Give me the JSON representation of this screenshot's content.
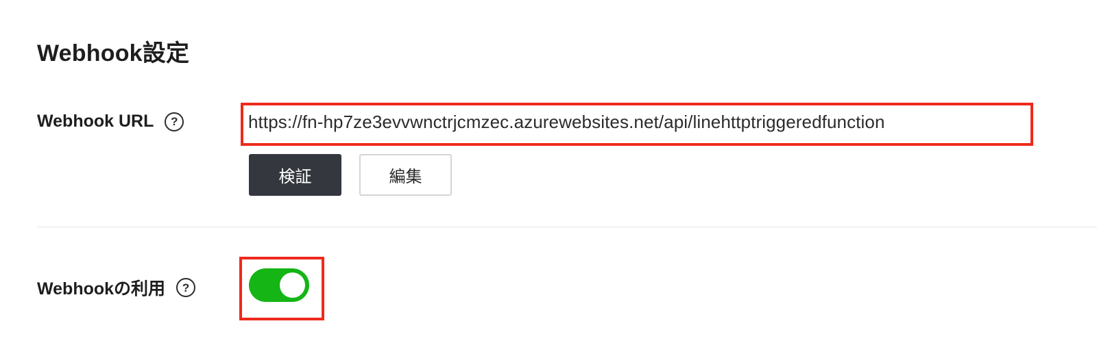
{
  "section": {
    "title": "Webhook設定"
  },
  "webhook_url": {
    "label": "Webhook URL",
    "help_icon": "question-circle-icon",
    "help_glyph": "?",
    "value": "https://fn-hp7ze3evvwnctrjcmzec.azurewebsites.net/api/linehttptriggeredfunction",
    "verify_button_label": "検証",
    "edit_button_label": "編集",
    "highlight_color": "#ee2a1b"
  },
  "webhook_use": {
    "label": "Webhookの利用",
    "help_icon": "question-circle-icon",
    "help_glyph": "?",
    "toggle_on": true,
    "toggle_color": "#14b514",
    "highlight_color": "#ee2a1b"
  }
}
